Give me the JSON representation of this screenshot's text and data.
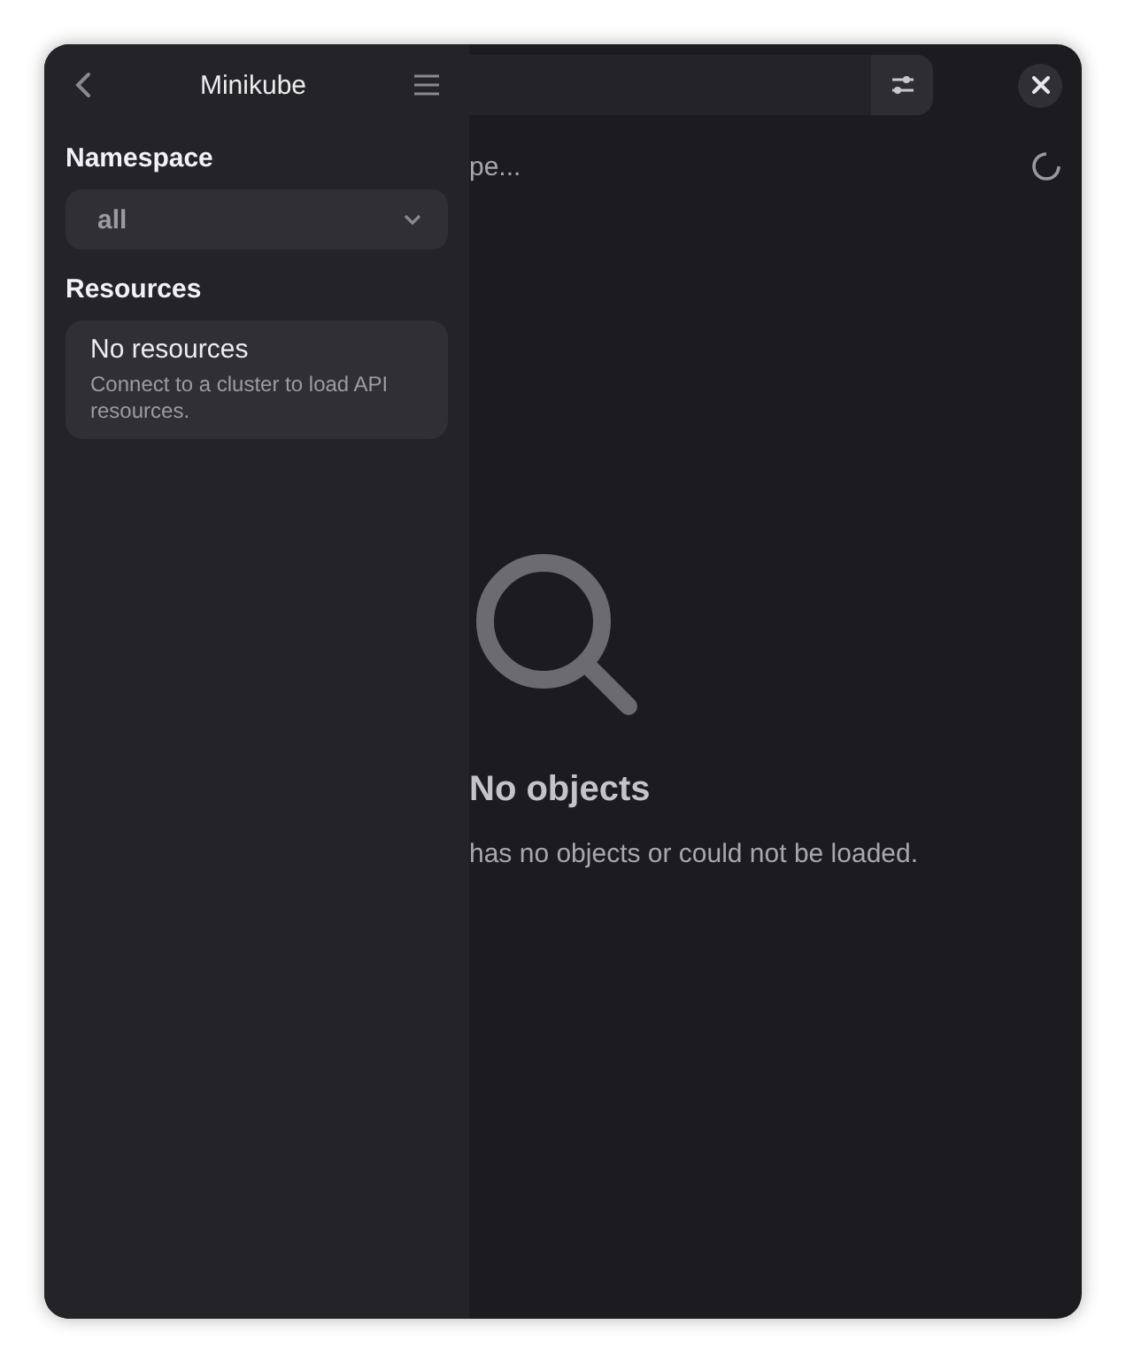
{
  "sidebar": {
    "title": "Minikube",
    "namespace": {
      "label": "Namespace",
      "value": "all"
    },
    "resources": {
      "label": "Resources",
      "empty_title": "No resources",
      "empty_text": "Connect to a cluster to load API resources."
    }
  },
  "main": {
    "status_text": "pe...",
    "empty_state": {
      "title": "No objects",
      "text": "has no objects or could not be loaded."
    }
  }
}
